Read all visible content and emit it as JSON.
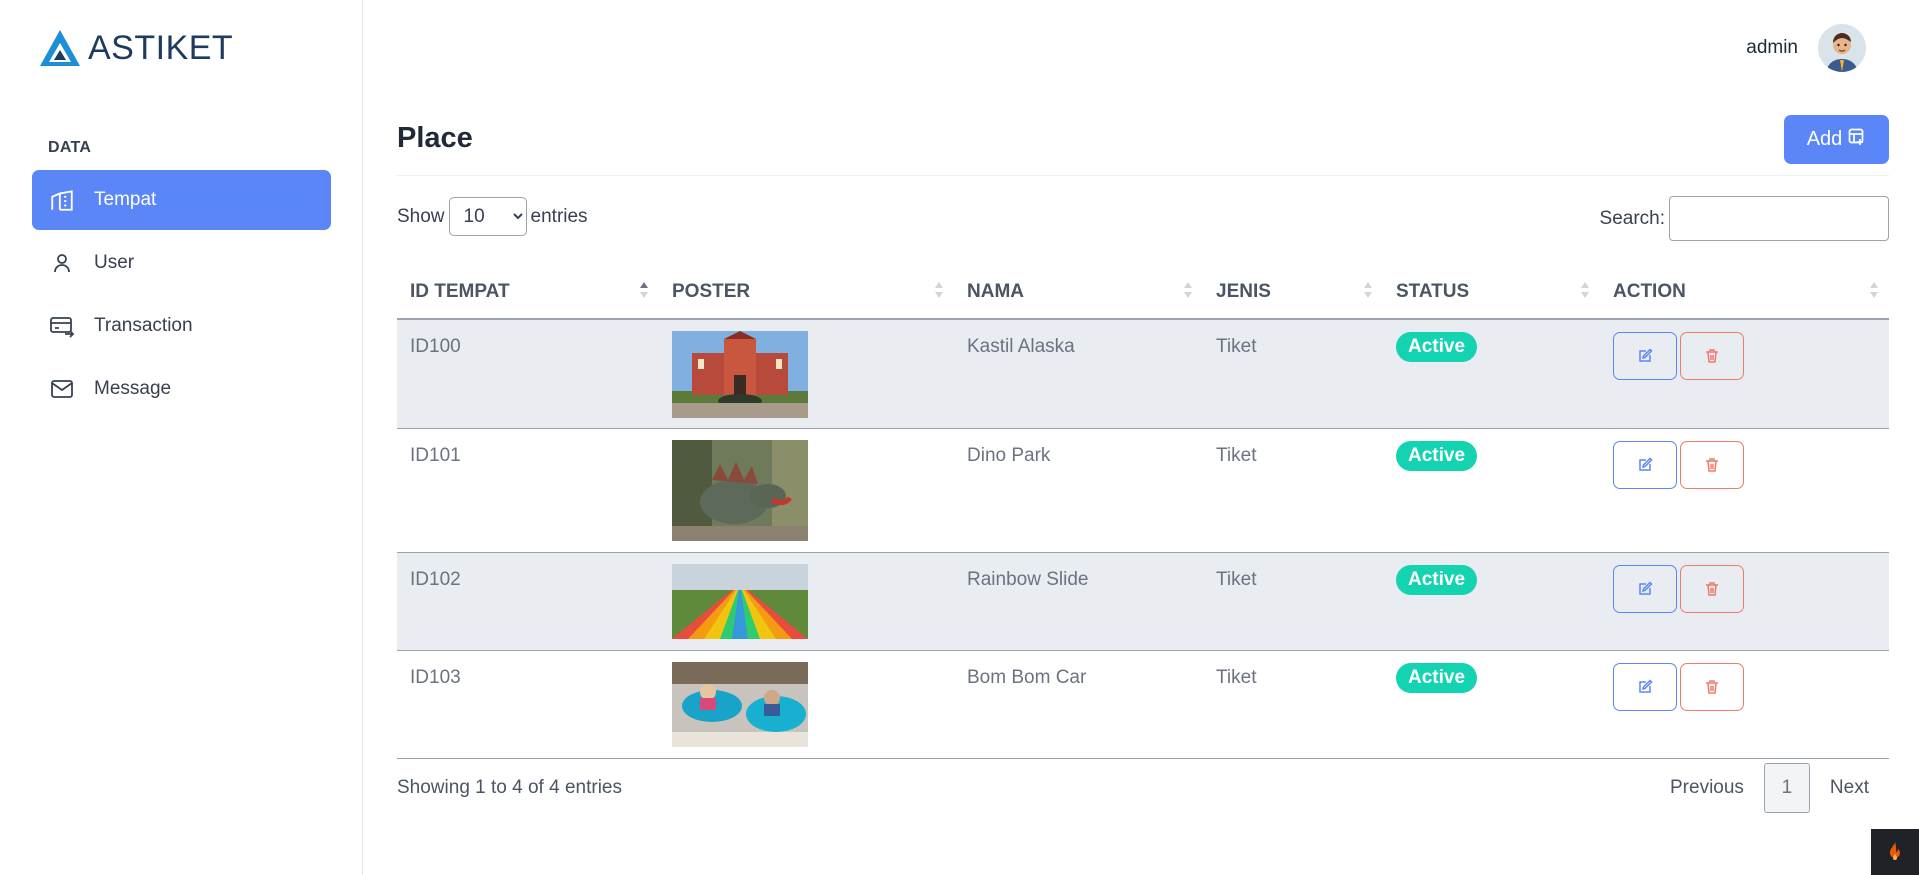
{
  "brand": {
    "name": "ASTIKET"
  },
  "sidebar": {
    "section_title": "DATA",
    "items": [
      {
        "label": "Tempat",
        "icon": "building-icon",
        "active": true
      },
      {
        "label": "User",
        "icon": "user-icon",
        "active": false
      },
      {
        "label": "Transaction",
        "icon": "card-transfer-icon",
        "active": false
      },
      {
        "label": "Message",
        "icon": "mail-icon",
        "active": false
      }
    ]
  },
  "header": {
    "user_name": "admin"
  },
  "page": {
    "title": "Place",
    "add_label": "Add"
  },
  "controls": {
    "show_label": "Show",
    "entries_value": "10",
    "entries_label": "entries",
    "search_label": "Search:",
    "search_value": ""
  },
  "table": {
    "columns": [
      "ID TEMPAT",
      "POSTER",
      "NAMA",
      "JENIS",
      "STATUS",
      "ACTION"
    ],
    "rows": [
      {
        "id": "ID100",
        "poster": "castle-photo",
        "nama": "Kastil Alaska",
        "jenis": "Tiket",
        "status": "Active"
      },
      {
        "id": "ID101",
        "poster": "dinosaur-photo",
        "nama": "Dino Park",
        "jenis": "Tiket",
        "status": "Active"
      },
      {
        "id": "ID102",
        "poster": "rainbow-slide-photo",
        "nama": "Rainbow Slide",
        "jenis": "Tiket",
        "status": "Active"
      },
      {
        "id": "ID103",
        "poster": "bumper-car-photo",
        "nama": "Bom Bom Car",
        "jenis": "Tiket",
        "status": "Active"
      }
    ]
  },
  "footer": {
    "info": "Showing 1 to 4 of 4 entries",
    "previous": "Previous",
    "current_page": "1",
    "next": "Next"
  },
  "colors": {
    "accent": "#5b86f7",
    "success": "#14d3b0",
    "danger": "#f07a6b"
  }
}
